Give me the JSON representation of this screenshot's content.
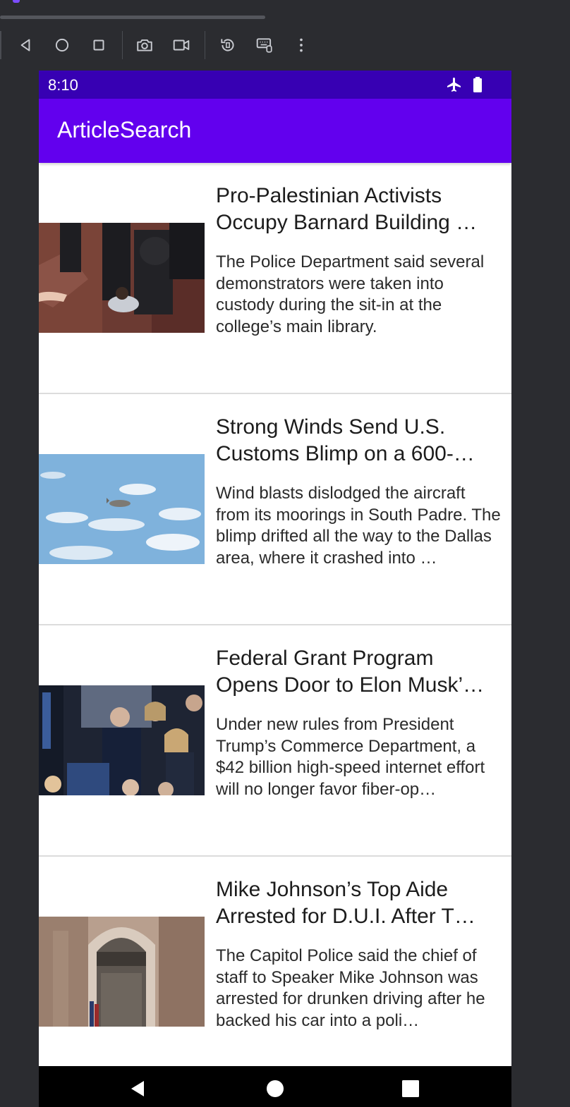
{
  "status_bar": {
    "time": "8:10"
  },
  "app_bar": {
    "title": "ArticleSearch"
  },
  "articles": [
    {
      "title": "Pro-Palestinian Activists Occupy Barnard Building …",
      "abstract": "The Police Department said several demonstrators were taken into custody during the sit-in at the college’s main library."
    },
    {
      "title": "Strong Winds Send U.S. Customs Blimp on a 600-…",
      "abstract": "Wind blasts dislodged the aircraft from its moorings in South Padre. The blimp drifted all the way to the Dallas area, where it crashed into …"
    },
    {
      "title": "Federal Grant Program Opens Door to Elon Musk’…",
      "abstract": "Under new rules from President Trump’s Commerce Department, a $42 billion high-speed internet effort will no longer favor fiber-op…"
    },
    {
      "title": "Mike Johnson’s Top Aide Arrested for D.U.I. After T…",
      "abstract": "The Capitol Police said the chief of staff to Speaker Mike Johnson was arrested for drunken driving after he backed his car into a poli…"
    }
  ],
  "icons": {
    "toolbar": [
      "back-triangle-icon",
      "home-circle-icon",
      "overview-square-icon",
      "camera-icon",
      "video-record-icon",
      "rotate-icon",
      "keyboard-icon",
      "more-vert-icon"
    ],
    "status": [
      "airplane-mode-icon",
      "battery-icon"
    ],
    "nav": [
      "nav-back-icon",
      "nav-home-icon",
      "nav-recents-icon"
    ]
  },
  "colors": {
    "status_bar": "#3700b3",
    "app_bar": "#6200ee",
    "nav_bar": "#000000",
    "emulator_bg": "#2b2c30"
  }
}
